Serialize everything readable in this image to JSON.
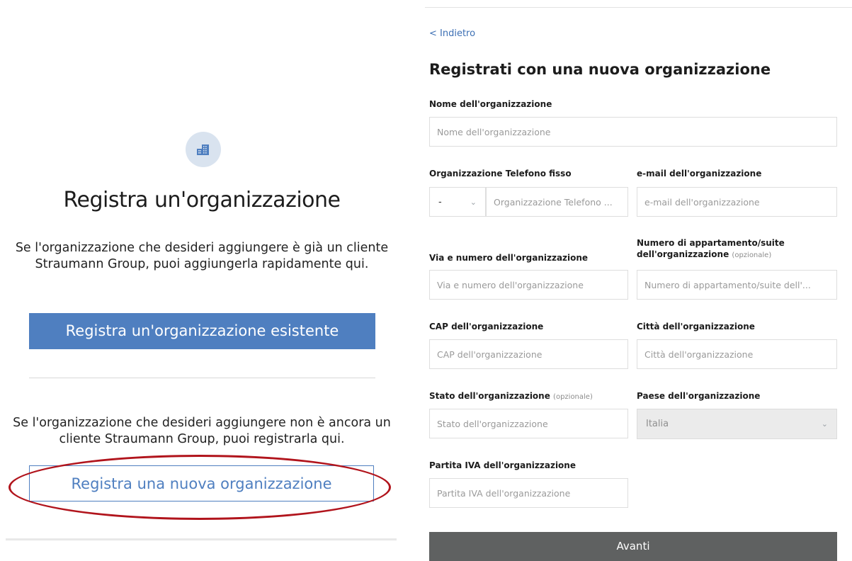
{
  "left": {
    "icon": "building-icon",
    "title": "Registra un'organizzazione",
    "text_existing": "Se l'organizzazione che desideri aggiungere è già un cliente Straumann Group, puoi aggiungerla rapidamente qui.",
    "btn_existing": "Registra un'organizzazione esistente",
    "text_new": "Se l'organizzazione che desideri aggiungere non è ancora un cliente Straumann Group, puoi registrarla qui.",
    "btn_new": "Registra una nuova organizzazione",
    "highlight_color": "#b1141c",
    "accent_color": "#4f7fc0"
  },
  "form": {
    "back": "< Indietro",
    "title": "Registrati con una nuova organizzazione",
    "name": {
      "label": "Nome dell'organizzazione",
      "placeholder": "Nome dell'organizzazione"
    },
    "phone": {
      "label": "Organizzazione Telefono fisso",
      "prefix": "-",
      "placeholder": "Organizzazione Telefono ..."
    },
    "email": {
      "label": "e-mail dell'organizzazione",
      "placeholder": "e-mail dell'organizzazione"
    },
    "street": {
      "label": "Via e numero dell'organizzazione",
      "placeholder": "Via e numero dell'organizzazione"
    },
    "suite": {
      "label": "Numero di appartamento/suite dell'organizzazione",
      "optional": "(opzionale)",
      "placeholder": "Numero di appartamento/suite dell'..."
    },
    "zip": {
      "label": "CAP dell'organizzazione",
      "placeholder": "CAP dell'organizzazione"
    },
    "city": {
      "label": "Città dell'organizzazione",
      "placeholder": "Città dell'organizzazione"
    },
    "state": {
      "label": "Stato dell'organizzazione",
      "optional": "(opzionale)",
      "placeholder": "Stato dell'organizzazione"
    },
    "country": {
      "label": "Paese dell'organizzazione",
      "value": "Italia"
    },
    "vat": {
      "label": "Partita IVA dell'organizzazione",
      "placeholder": "Partita IVA dell'organizzazione"
    },
    "next": "Avanti"
  }
}
